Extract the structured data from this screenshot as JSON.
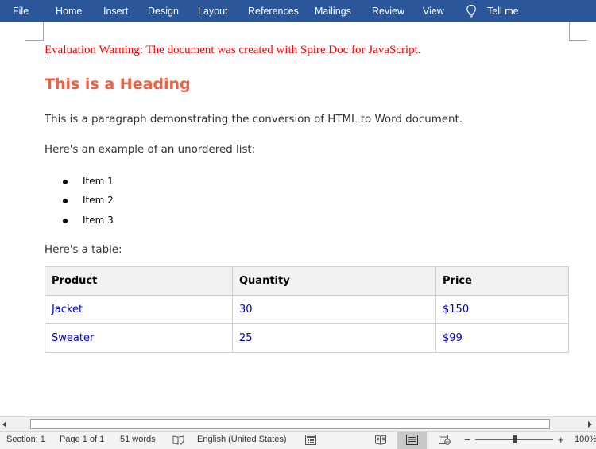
{
  "ribbon": {
    "tabs": [
      "File",
      "Home",
      "Insert",
      "Design",
      "Layout",
      "References",
      "Mailings",
      "Review",
      "View"
    ],
    "tell_me": "Tell me",
    "background": "#2b579a"
  },
  "document": {
    "warning": "Evaluation Warning: The document was created with Spire.Doc for JavaScript.",
    "heading": "This is a Heading",
    "paragraph1": "This is a paragraph demonstrating the conversion of HTML to Word document.",
    "paragraph2": "Here's an example of an unordered list:",
    "list_items": [
      "Item 1",
      "Item 2",
      "Item 3"
    ],
    "paragraph3": "Here's a table:",
    "table": {
      "headers": [
        "Product",
        "Quantity",
        "Price"
      ],
      "rows": [
        [
          "Jacket",
          "30",
          "$150"
        ],
        [
          "Sweater",
          "25",
          "$99"
        ]
      ]
    },
    "colors": {
      "warning": "#ff0000",
      "heading": "#f06040",
      "cell_text": "#0000cc"
    }
  },
  "statusbar": {
    "section": "Section: 1",
    "page": "Page 1 of 1",
    "words": "51 words",
    "language": "English (United States)",
    "zoom_minus": "−",
    "zoom_plus": "+",
    "zoom": "100%"
  }
}
